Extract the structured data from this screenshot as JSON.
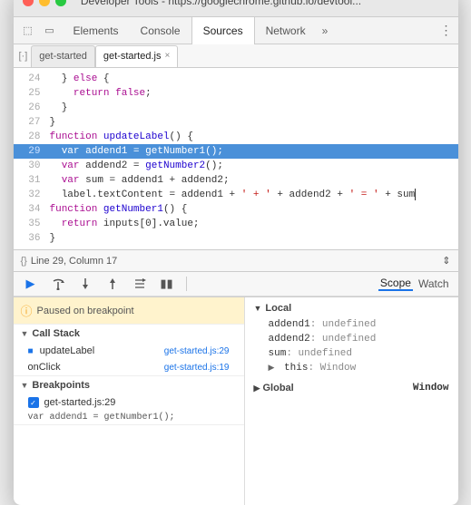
{
  "window": {
    "title": "Developer Tools - https://googlechrome.github.io/devtool..."
  },
  "traffic_lights": {
    "close": "close",
    "minimize": "minimize",
    "maximize": "maximize"
  },
  "nav": {
    "tabs": [
      {
        "label": "Elements",
        "active": false
      },
      {
        "label": "Console",
        "active": false
      },
      {
        "label": "Sources",
        "active": true
      },
      {
        "label": "Network",
        "active": false
      }
    ],
    "more": "»",
    "menu": "⋮"
  },
  "file_tabs": [
    {
      "label": "get-started",
      "active": false,
      "closeable": false
    },
    {
      "label": "get-started.js",
      "active": true,
      "closeable": true
    }
  ],
  "code": {
    "lines": [
      {
        "num": 24,
        "text": "  } else {",
        "highlighted": false
      },
      {
        "num": 25,
        "text": "    return false;",
        "highlighted": false
      },
      {
        "num": 26,
        "text": "  }",
        "highlighted": false
      },
      {
        "num": 27,
        "text": "}",
        "highlighted": false
      },
      {
        "num": 28,
        "text": "function updateLabel() {",
        "highlighted": false
      },
      {
        "num": 29,
        "text": "  var addend1 = getNumber1();",
        "highlighted": true
      },
      {
        "num": 30,
        "text": "  var addend2 = getNumber2();",
        "highlighted": false
      },
      {
        "num": 31,
        "text": "  var sum = addend1 + addend2;",
        "highlighted": false
      },
      {
        "num": 32,
        "text": "  label.textContent = addend1 + ' + ' + addend2 + ' = ' + sum",
        "highlighted": false
      },
      {
        "num": 34,
        "text": "function getNumber1() {",
        "highlighted": false
      },
      {
        "num": 35,
        "text": "  return inputs[0].value;",
        "highlighted": false
      },
      {
        "num": 36,
        "text": "}",
        "highlighted": false
      }
    ],
    "cursor_line": "  label.textContent"
  },
  "status_bar": {
    "icon": "{}",
    "text": "Line 29, Column 17",
    "scroll_icon": "↕"
  },
  "debug_toolbar": {
    "buttons": [
      {
        "icon": "▶",
        "label": "resume",
        "active": true
      },
      {
        "icon": "↩",
        "label": "step-over"
      },
      {
        "icon": "↓",
        "label": "step-into"
      },
      {
        "icon": "↑",
        "label": "step-out"
      },
      {
        "icon": "⇅",
        "label": "step"
      },
      {
        "icon": "⏸",
        "label": "pause"
      }
    ]
  },
  "bottom_panel": {
    "left": {
      "pause_banner": "Paused on breakpoint",
      "call_stack": {
        "header": "Call Stack",
        "items": [
          {
            "name": "updateLabel",
            "file": "get-started.js:29",
            "has_icon": true
          },
          {
            "name": "onClick",
            "file": "get-started.js:19",
            "has_icon": false
          }
        ]
      },
      "breakpoints": {
        "header": "Breakpoints",
        "items": [
          {
            "label": "get-started.js:29",
            "checked": true
          }
        ],
        "code_preview": "var addend1 = getNumber1();"
      }
    },
    "right": {
      "tabs": [
        {
          "label": "Scope",
          "active": true
        },
        {
          "label": "Watch",
          "active": false
        }
      ],
      "local_section": {
        "label": "Local",
        "vars": [
          {
            "name": "addend1",
            "value": "undefined"
          },
          {
            "name": "addend2",
            "value": "undefined"
          },
          {
            "name": "sum",
            "value": "undefined"
          },
          {
            "name": "this",
            "value": "Window",
            "has_arrow": true
          }
        ]
      },
      "global_section": {
        "label": "Global",
        "value": "Window"
      }
    }
  }
}
